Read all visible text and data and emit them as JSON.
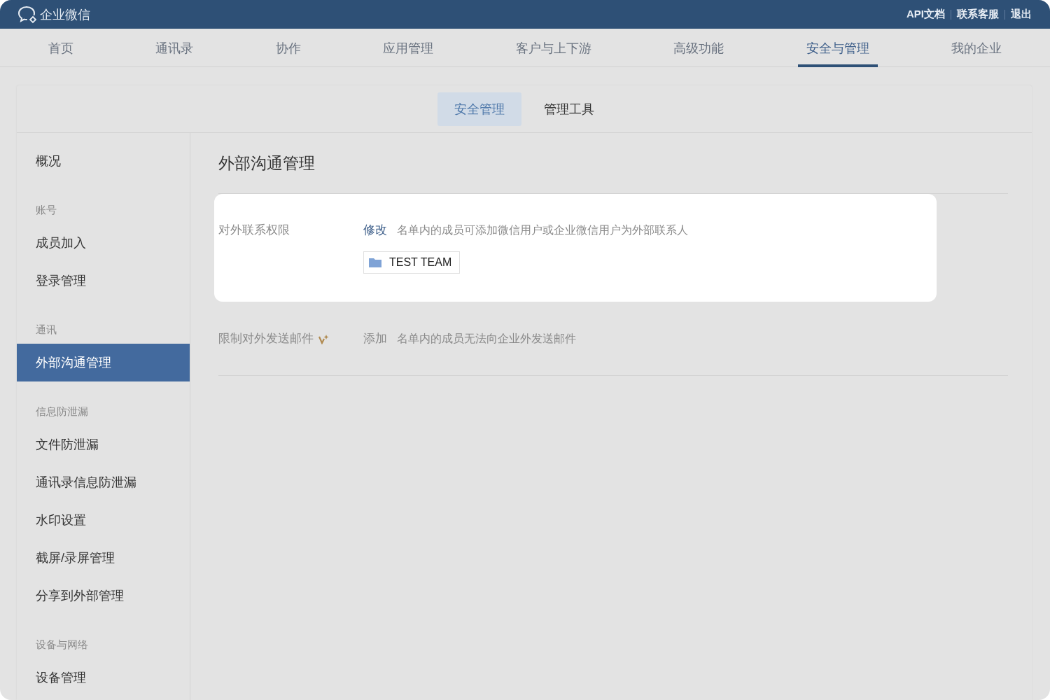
{
  "header": {
    "logo": "企业微信",
    "links": [
      "API文档",
      "联系客服",
      "退出"
    ]
  },
  "nav": [
    {
      "label": "首页",
      "selected": false
    },
    {
      "label": "通讯录",
      "selected": false
    },
    {
      "label": "协作",
      "selected": false
    },
    {
      "label": "应用管理",
      "selected": false
    },
    {
      "label": "客户与上下游",
      "selected": false
    },
    {
      "label": "高级功能",
      "selected": false
    },
    {
      "label": "安全与管理",
      "selected": true
    },
    {
      "label": "我的企业",
      "selected": false
    }
  ],
  "subtabs": [
    {
      "label": "安全管理",
      "selected": true
    },
    {
      "label": "管理工具",
      "selected": false
    }
  ],
  "sidebar": [
    {
      "items": [
        {
          "label": "概况",
          "selected": false
        }
      ]
    },
    {
      "heading": "账号",
      "items": [
        {
          "label": "成员加入",
          "selected": false
        },
        {
          "label": "登录管理",
          "selected": false
        }
      ]
    },
    {
      "heading": "通讯",
      "items": [
        {
          "label": "外部沟通管理",
          "selected": true
        }
      ]
    },
    {
      "heading": "信息防泄漏",
      "items": [
        {
          "label": "文件防泄漏",
          "selected": false
        },
        {
          "label": "通讯录信息防泄漏",
          "selected": false
        },
        {
          "label": "水印设置",
          "selected": false
        },
        {
          "label": "截屏/录屏管理",
          "selected": false
        },
        {
          "label": "分享到外部管理",
          "selected": false
        }
      ]
    },
    {
      "heading": "设备与网络",
      "items": [
        {
          "label": "设备管理",
          "selected": false
        }
      ]
    }
  ],
  "page_title": "外部沟通管理",
  "settings": [
    {
      "label": "对外联系权限",
      "premium": false,
      "highlighted": true,
      "action": "修改",
      "description": "名单内的成员可添加微信用户或企业微信用户为外部联系人",
      "tags": [
        "TEST TEAM"
      ]
    },
    {
      "label": "限制对外发送邮件",
      "premium": true,
      "highlighted": false,
      "action": "添加",
      "description": "名单内的成员无法向企业外发送邮件"
    }
  ]
}
